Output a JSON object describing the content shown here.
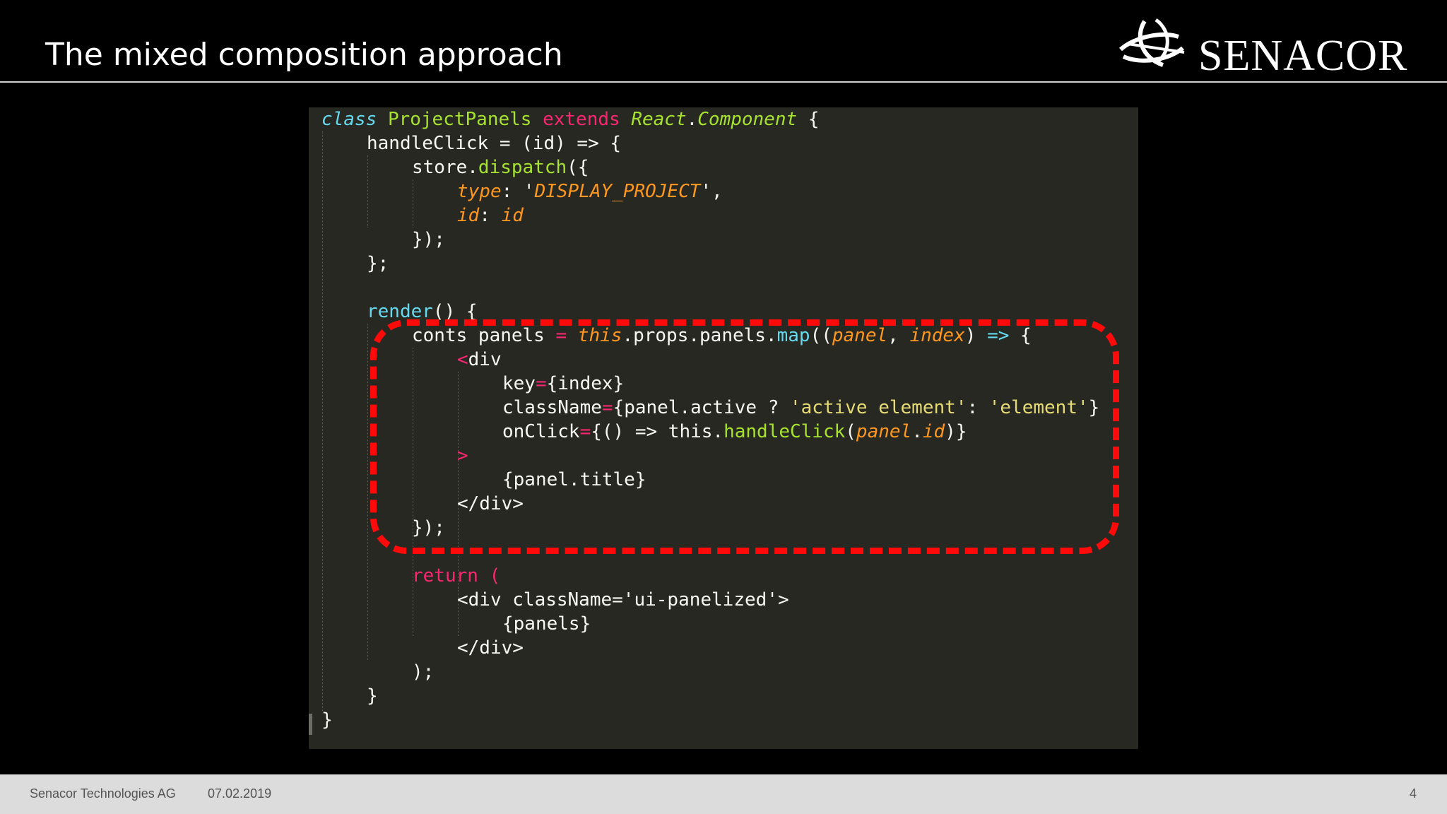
{
  "slide": {
    "title": "The mixed composition approach",
    "logo_text": "SENACOR",
    "logo_icon": "senacor-swirl-logo-icon"
  },
  "code": {
    "l1": {
      "a": "class",
      "b": " ",
      "c": "ProjectPanels",
      "d": " ",
      "e": "extends",
      "f": " ",
      "g": "React",
      "h": ".",
      "i": "Component",
      "j": " {"
    },
    "l2": {
      "a": "handleClick = (id) => {"
    },
    "l3": {
      "a": "store.",
      "b": "dispatch",
      "c": "({"
    },
    "l4": {
      "a": "type",
      "b": ": '",
      "c": "DISPLAY_PROJECT",
      "d": "',"
    },
    "l5": {
      "a": "id",
      "b": ": ",
      "c": "id"
    },
    "l6": {
      "a": "});"
    },
    "l7": {
      "a": "};"
    },
    "l8": {
      "a": "render",
      "b": "() {"
    },
    "l9": {
      "a": "conts panels ",
      "b": "=",
      "c": " ",
      "d": "this",
      "e": ".props.panels.",
      "f": "map",
      "g": "((",
      "h": "panel",
      "i": ", ",
      "j": "index",
      "k": ") ",
      "l": "=>",
      "m": " {"
    },
    "l10": {
      "a": "<",
      "b": "div"
    },
    "l11": {
      "a": "key",
      "b": "=",
      "c": "{index}"
    },
    "l12": {
      "a": "className",
      "b": "=",
      "c": "{panel.active ? ",
      "d": "'active element'",
      "e": ": ",
      "f": "'element'",
      "g": "}"
    },
    "l13": {
      "a": "onClick",
      "b": "=",
      "c": "{() => this.",
      "d": "handleClick",
      "e": "(",
      "f": "panel",
      "g": ".",
      "h": "id",
      "i": ")}"
    },
    "l14": {
      "a": ">"
    },
    "l15": {
      "a": "{panel.title}"
    },
    "l16": {
      "a": "</div>"
    },
    "l17": {
      "a": "});"
    },
    "l18": {
      "a": "return ("
    },
    "l19": {
      "a": "<div className='ui-panelized'>"
    },
    "l20": {
      "a": "{panels}"
    },
    "l21": {
      "a": "</div>"
    },
    "l22": {
      "a": ");"
    },
    "l23": {
      "a": "}"
    },
    "l24": {
      "a": "}"
    }
  },
  "footer": {
    "company": "Senacor Technologies AG",
    "date": "07.02.2019",
    "page": "4"
  },
  "colors": {
    "highlight_box": "#ff0a0a",
    "editor_bg": "#272822"
  }
}
